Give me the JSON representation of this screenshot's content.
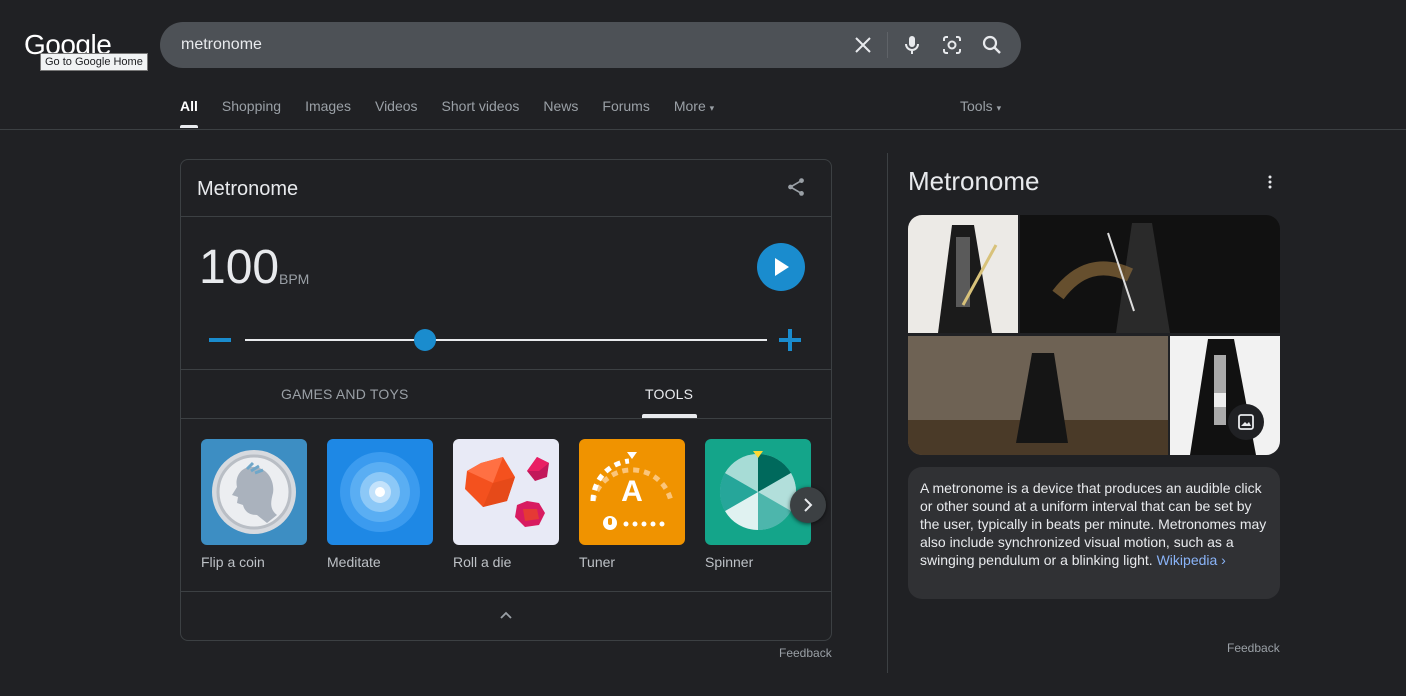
{
  "header": {
    "logo_text": "Google",
    "logo_tooltip": "Go to Google Home",
    "search_query": "metronome"
  },
  "tabs": [
    {
      "label": "All",
      "active": true
    },
    {
      "label": "Shopping"
    },
    {
      "label": "Images"
    },
    {
      "label": "Videos"
    },
    {
      "label": "Short videos"
    },
    {
      "label": "News"
    },
    {
      "label": "Forums"
    },
    {
      "label": "More"
    }
  ],
  "tools_label": "Tools",
  "metronome": {
    "title": "Metronome",
    "bpm": "100",
    "bpm_unit": "BPM",
    "tab_games": "GAMES AND TOYS",
    "tab_tools": "TOOLS",
    "tools": [
      "Flip a coin",
      "Meditate",
      "Roll a die",
      "Tuner",
      "Spinner"
    ],
    "tuner_letter": "A",
    "feedback": "Feedback"
  },
  "knowledge_panel": {
    "title": "Metronome",
    "description": "A metronome is a device that produces an audible click or other sound at a uniform interval that can be set by the user, typically in beats per minute. Metronomes may also include synchronized visual motion, such as a swinging pendulum or a blinking light.",
    "source_link": "Wikipedia ›",
    "feedback": "Feedback"
  },
  "colors": {
    "accent_blue": "#1a8cce",
    "background": "#202124",
    "link": "#8ab4f8"
  }
}
